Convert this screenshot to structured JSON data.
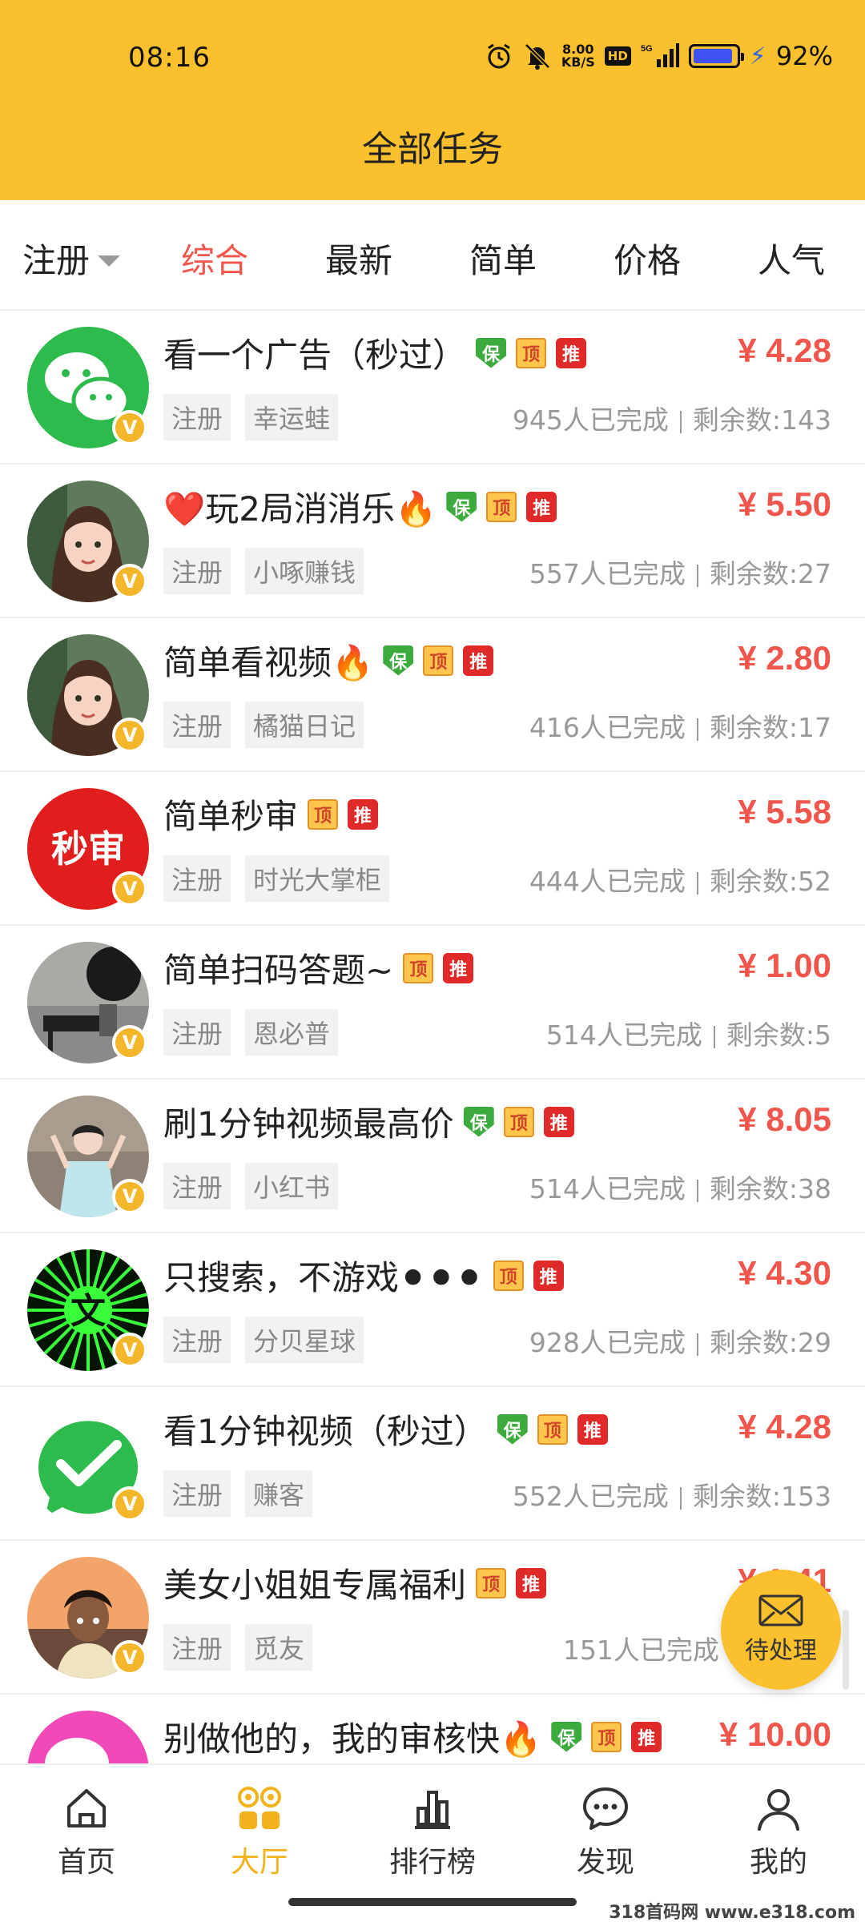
{
  "status_bar": {
    "time": "08:16",
    "net_speed_value": "8.00",
    "net_speed_unit": "KB/S",
    "hd": "HD",
    "signal": "5G",
    "battery_level": 92,
    "battery_text": "92%"
  },
  "header": {
    "title": "全部任务"
  },
  "filter_tabs": {
    "dropdown": "注册",
    "tabs": [
      "综合",
      "最新",
      "简单",
      "价格",
      "人气"
    ],
    "active_tab": "综合"
  },
  "tag_labels": {
    "bao": "保",
    "ding": "顶",
    "tui": "推"
  },
  "verified_badge": "V",
  "tasks": [
    {
      "title": "看一个广告（秒过）",
      "tags": [
        "bao",
        "ding",
        "tui"
      ],
      "price": "¥ 4.28",
      "category": "注册",
      "publisher": "幸运蛙",
      "completed": "945人已完成",
      "remaining": "剩余数:143",
      "avatar": "wechat-green"
    },
    {
      "title": "❤️玩2局消消乐🔥",
      "tags": [
        "bao",
        "ding",
        "tui"
      ],
      "price": "¥ 5.50",
      "category": "注册",
      "publisher": "小啄赚钱",
      "completed": "557人已完成",
      "remaining": "剩余数:27",
      "avatar": "girl-photo"
    },
    {
      "title": "简单看视频🔥",
      "tags": [
        "bao",
        "ding",
        "tui"
      ],
      "price": "¥ 2.80",
      "category": "注册",
      "publisher": "橘猫日记",
      "completed": "416人已完成",
      "remaining": "剩余数:17",
      "avatar": "girl-photo"
    },
    {
      "title": "简单秒审",
      "tags": [
        "ding",
        "tui"
      ],
      "price": "¥ 5.58",
      "category": "注册",
      "publisher": "时光大掌柜",
      "completed": "444人已完成",
      "remaining": "剩余数:52",
      "avatar": "miaoshen-red",
      "avatar_text": "秒审"
    },
    {
      "title": "简单扫码答题~",
      "tags": [
        "ding",
        "tui"
      ],
      "price": "¥ 1.00",
      "category": "注册",
      "publisher": "恩必普",
      "completed": "514人已完成",
      "remaining": "剩余数:5",
      "avatar": "dark-room"
    },
    {
      "title": "刷1分钟视频最高价",
      "tags": [
        "bao",
        "ding",
        "tui"
      ],
      "price": "¥ 8.05",
      "category": "注册",
      "publisher": "小红书",
      "completed": "514人已完成",
      "remaining": "剩余数:38",
      "avatar": "woman-photo"
    },
    {
      "title": "只搜索，不游戏⚫⚫⚫",
      "tags": [
        "ding",
        "tui"
      ],
      "price": "¥ 4.30",
      "category": "注册",
      "publisher": "分贝星球",
      "completed": "928人已完成",
      "remaining": "剩余数:29",
      "avatar": "green-burst",
      "avatar_text": "文"
    },
    {
      "title": "看1分钟视频（秒过）",
      "tags": [
        "bao",
        "ding",
        "tui"
      ],
      "price": "¥ 4.28",
      "category": "注册",
      "publisher": "赚客",
      "completed": "552人已完成",
      "remaining": "剩余数:153",
      "avatar": "green-check"
    },
    {
      "title": "美女小姐姐专属福利",
      "tags": [
        "ding",
        "tui"
      ],
      "price": "¥ 1.41",
      "category": "注册",
      "publisher": "觅友",
      "completed": "151人已完成",
      "remaining": "剩余数:",
      "avatar": "anime-boy"
    },
    {
      "title": "别做他的，我的审核快🔥",
      "tags": [
        "bao",
        "ding",
        "tui"
      ],
      "price": "¥ 10.00",
      "category": "",
      "publisher": "",
      "completed": "",
      "remaining": "",
      "avatar": "wechat-pink"
    }
  ],
  "fab": {
    "label": "待处理",
    "icon": "mail-icon"
  },
  "bottom_nav": [
    {
      "label": "首页",
      "icon": "home-icon"
    },
    {
      "label": "大厅",
      "icon": "grid-icon",
      "active": true
    },
    {
      "label": "排行榜",
      "icon": "ranking-icon"
    },
    {
      "label": "发现",
      "icon": "chat-bubble-icon"
    },
    {
      "label": "我的",
      "icon": "user-icon"
    }
  ],
  "watermark": "318首码网 www.e318.com",
  "colors": {
    "header": "#FBC02D",
    "accent_red": "#F0564B",
    "active_nav": "#F2B21B"
  }
}
